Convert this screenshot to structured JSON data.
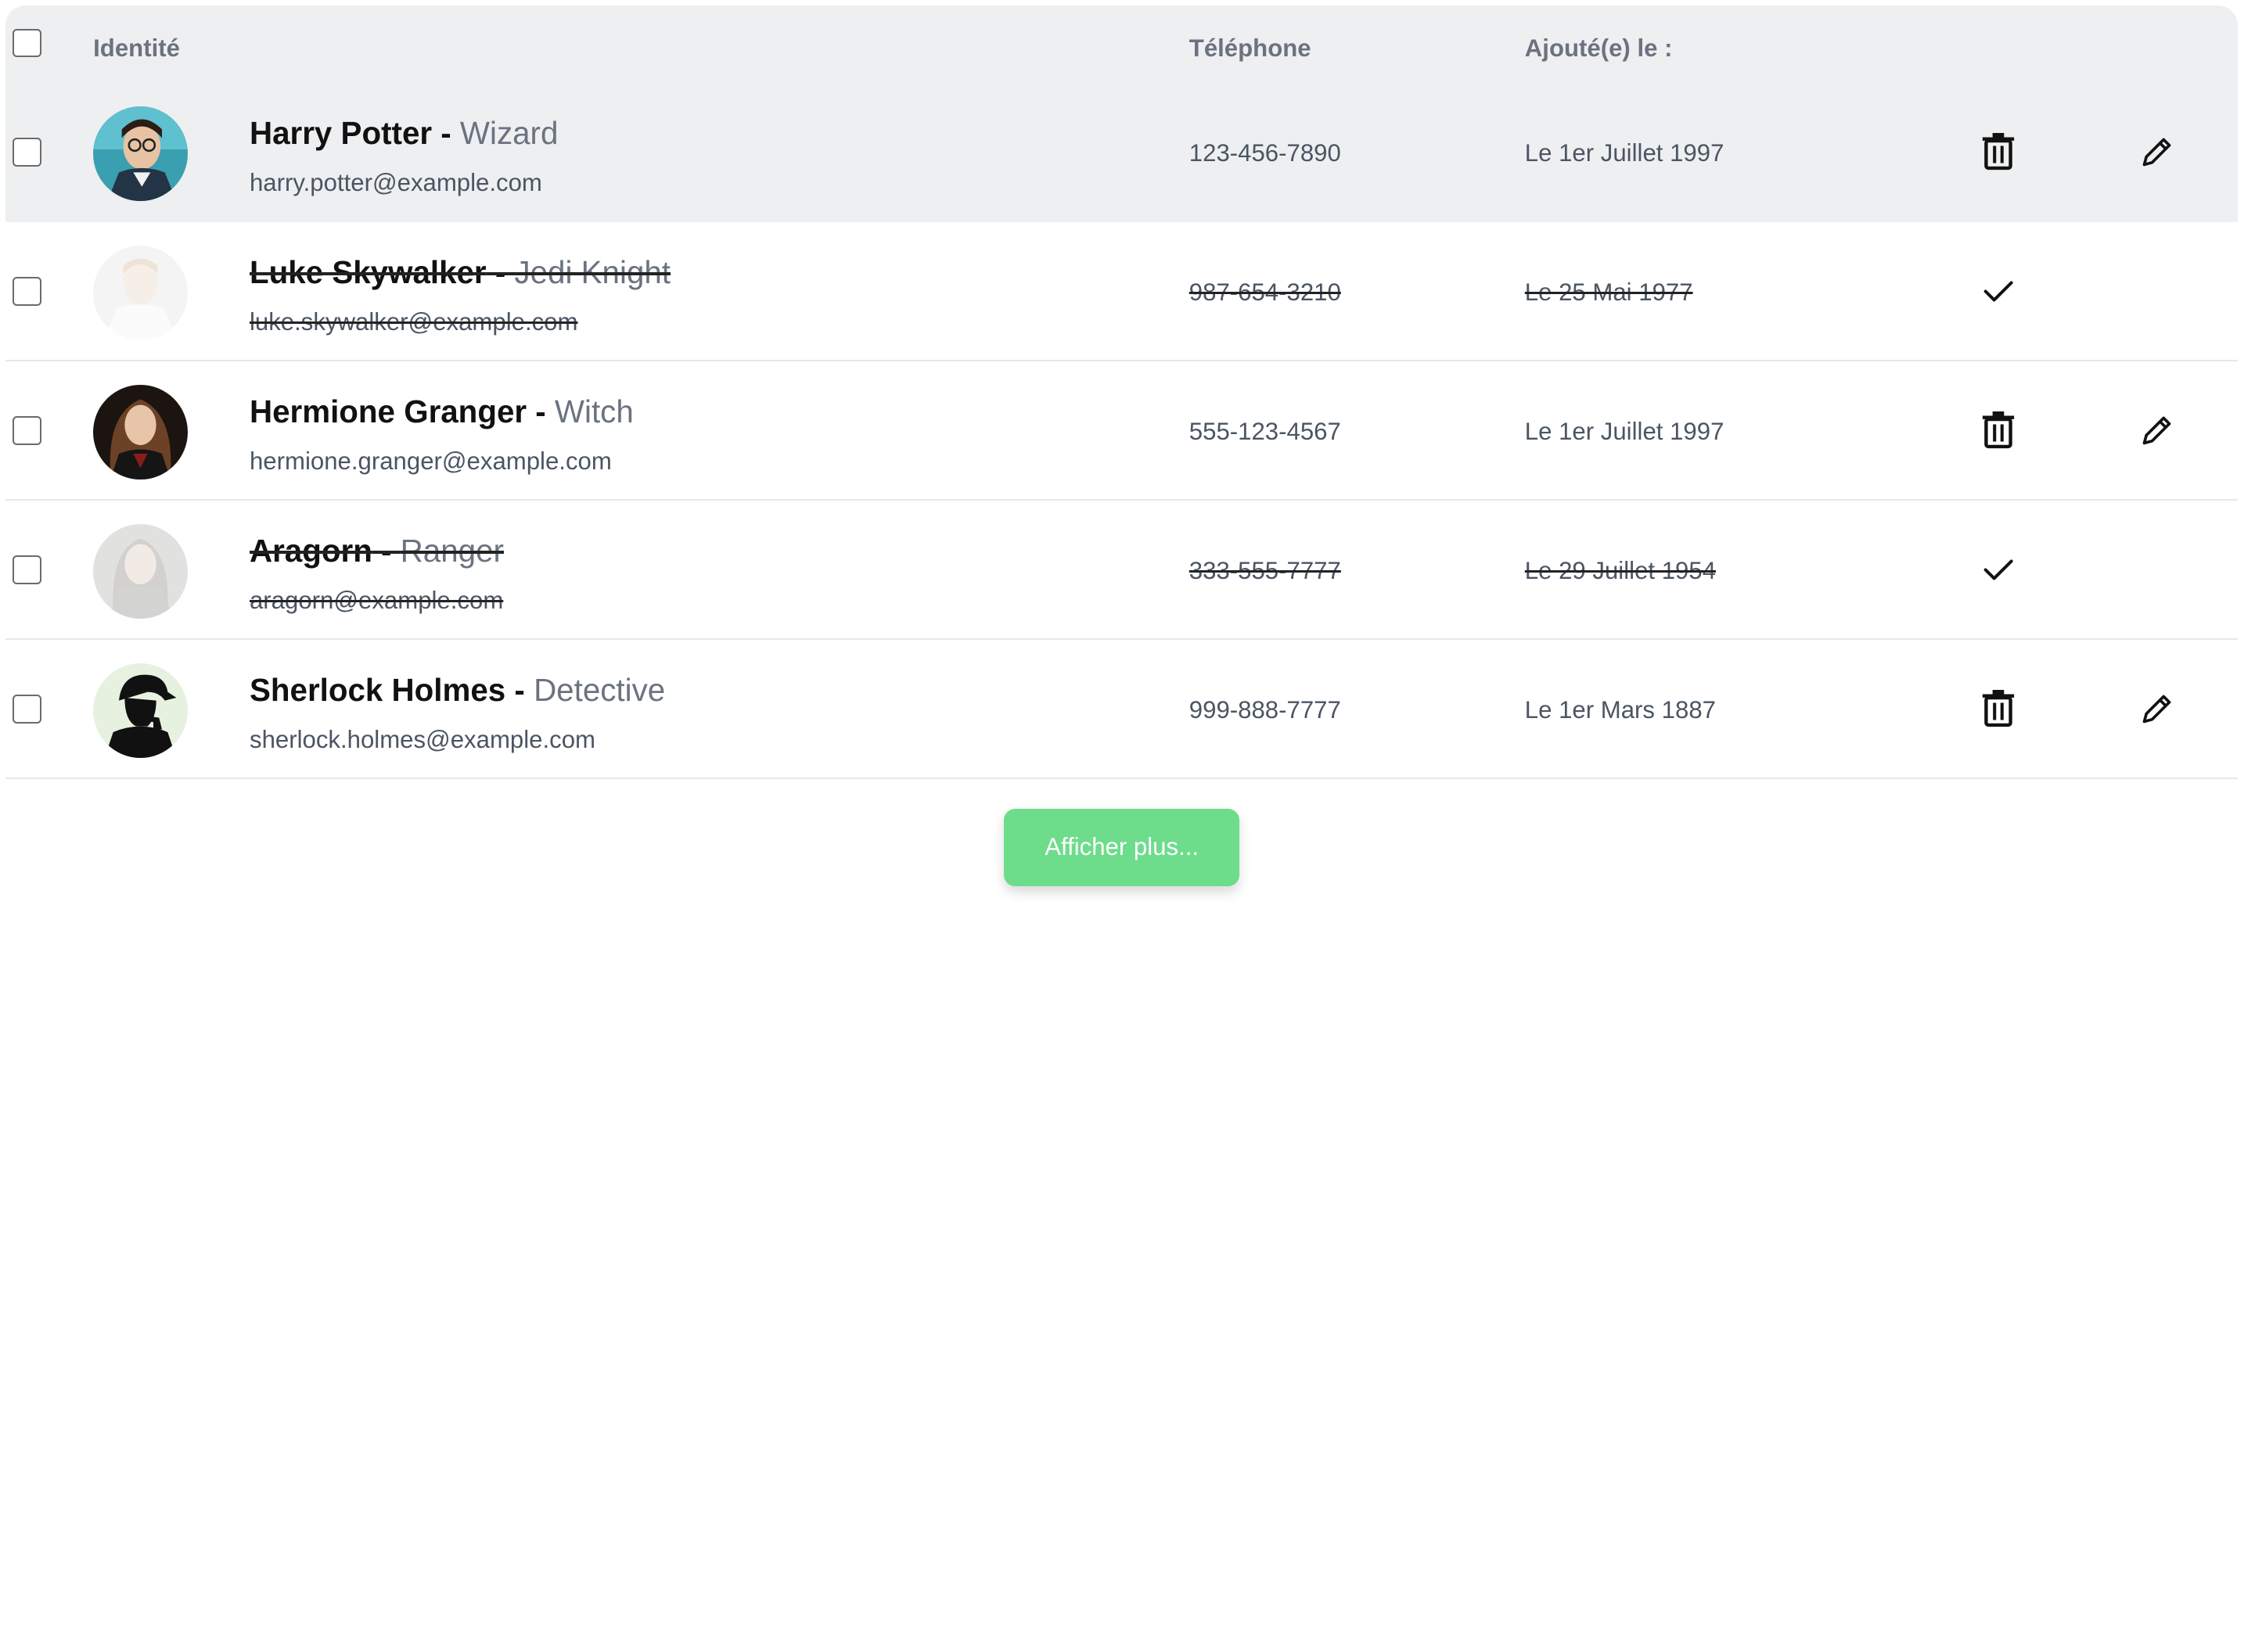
{
  "table": {
    "headers": {
      "identity": "Identité",
      "phone": "Téléphone",
      "added": "Ajouté(e) le :"
    },
    "rows": [
      {
        "name": "Harry Potter",
        "separator": " - ",
        "role": "Wizard",
        "email": "harry.potter@example.com",
        "phone": "123-456-7890",
        "date": "Le 1er Juillet 1997",
        "done": false,
        "avatar": "harry-potter-avatar"
      },
      {
        "name": "Luke Skywalker",
        "separator": " - ",
        "role": "Jedi Knight",
        "email": "luke.skywalker@example.com",
        "phone": "987-654-3210",
        "date": "Le 25 Mai 1977",
        "done": true,
        "avatar": "luke-skywalker-avatar"
      },
      {
        "name": "Hermione Granger",
        "separator": " - ",
        "role": "Witch",
        "email": "hermione.granger@example.com",
        "phone": "555-123-4567",
        "date": "Le 1er Juillet 1997",
        "done": false,
        "avatar": "hermione-granger-avatar"
      },
      {
        "name": "Aragorn",
        "separator": " - ",
        "role": "Ranger",
        "email": "aragorn@example.com",
        "phone": "333-555-7777",
        "date": "Le 29 Juillet 1954",
        "done": true,
        "avatar": "aragorn-avatar"
      },
      {
        "name": "Sherlock Holmes",
        "separator": " - ",
        "role": "Detective",
        "email": "sherlock.holmes@example.com",
        "phone": "999-888-7777",
        "date": "Le 1er Mars 1887",
        "done": false,
        "avatar": "sherlock-holmes-avatar"
      }
    ]
  },
  "footer": {
    "more_label": "Afficher plus..."
  },
  "colors": {
    "header_bg": "#eeeff1",
    "button_green": "#6ddc8b",
    "muted_text": "#6b7280"
  },
  "icons": {
    "delete": "trash-icon",
    "edit": "pencil-icon",
    "restore": "check-icon"
  }
}
